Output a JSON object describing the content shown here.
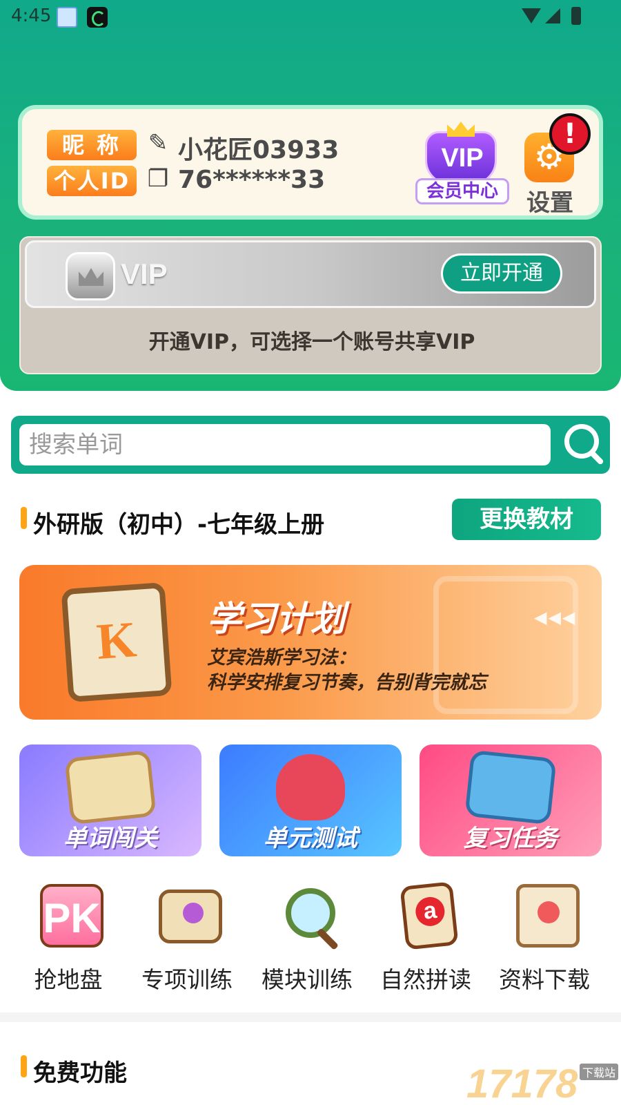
{
  "status_bar": {
    "time": "4:45"
  },
  "profile": {
    "nickname_tag": "昵称",
    "id_tag": "个人ID",
    "nickname": "小花匠03933",
    "user_id": "76******33",
    "vip_word": "VIP",
    "vip_center_label": "会员中心",
    "settings_label": "设置",
    "settings_badge": "!"
  },
  "vip_card": {
    "banner_text": "VIP",
    "activate_label": "立即开通",
    "description": "开通VIP，可选择一个账号共享VIP"
  },
  "search": {
    "placeholder": "搜索单词"
  },
  "textbook": {
    "title": "外研版（初中）-七年级上册",
    "change_label": "更换教材"
  },
  "study_plan": {
    "book_letter": "K",
    "title": "学习计划",
    "subtitle_line1": "艾宾浩斯学习法：",
    "subtitle_line2": "科学安排复习节奏，告别背完就忘",
    "arrows": "◀◀◀"
  },
  "tiles": [
    {
      "label": "单词闯关"
    },
    {
      "label": "单元测试"
    },
    {
      "label": "复习任务"
    }
  ],
  "features": [
    {
      "label": "抢地盘",
      "art": "PK"
    },
    {
      "label": "专项训练"
    },
    {
      "label": "模块训练"
    },
    {
      "label": "自然拼读"
    },
    {
      "label": "资料下载"
    }
  ],
  "free_section": {
    "title": "免费功能"
  },
  "watermark": {
    "number": "17178",
    "tag": "下载站"
  },
  "colors": {
    "header_green": "#10a98a",
    "accent_orange": "#ffa417",
    "primary_button": "#0fa083"
  }
}
